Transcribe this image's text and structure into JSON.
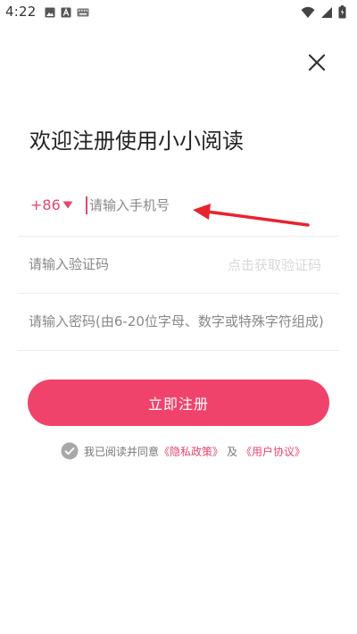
{
  "status_bar": {
    "time": "4:22",
    "left_icons": [
      "image-icon",
      "a-badge-icon",
      "keyboard-icon"
    ],
    "right_icons": [
      "wifi-icon",
      "signal-icon",
      "battery-icon"
    ]
  },
  "header": {
    "close_icon": "close-icon",
    "title": "欢迎注册使用小小阅读"
  },
  "form": {
    "country_code": "+86",
    "phone_placeholder": "请输入手机号",
    "code_placeholder": "请输入验证码",
    "get_code_label": "点击获取验证码",
    "password_placeholder": "请输入密码(由6-20位字母、数字或特殊字符组成)",
    "register_label": "立即注册"
  },
  "agreement": {
    "prefix": "我已阅读并同意",
    "privacy_label": "《隐私政策》",
    "and_label": "及",
    "terms_label": "《用户协议》",
    "checked": true
  },
  "colors": {
    "accent": "#f0436c",
    "link": "#e8456d",
    "annotation_arrow": "#e8232e"
  }
}
